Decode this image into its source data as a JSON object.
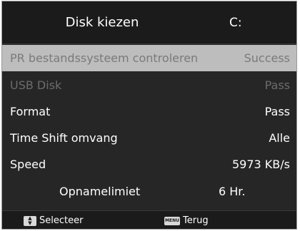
{
  "header": {
    "title": "Disk kiezen",
    "value": "C:"
  },
  "rows": [
    {
      "label": "PR bestandssysteem controleren",
      "value": "Success"
    },
    {
      "label": "USB Disk",
      "value": "Pass"
    },
    {
      "label": "Format",
      "value": "Pass"
    },
    {
      "label": "Time Shift omvang",
      "value": "Alle"
    },
    {
      "label": "Speed",
      "value": "5973 KB/s"
    },
    {
      "label": "Opnamelimiet",
      "value": "6 Hr."
    }
  ],
  "footer": {
    "select_label": "Selecteer",
    "back_label": "Terug",
    "menu_key": "MENU"
  },
  "icons": {
    "select": "up-down-arrows-icon",
    "back": "menu-key-icon"
  }
}
